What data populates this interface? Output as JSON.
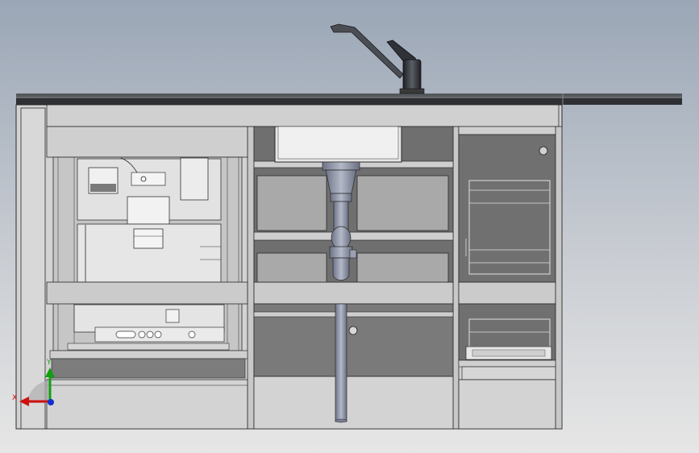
{
  "view": {
    "title": "",
    "colors": {
      "background_top": "#9aa6b6",
      "background_bottom": "#e6e6e6",
      "cabinet_face": "#d3d3d3",
      "cabinet_dark": "#6f6f6f",
      "line": "#2a2a2a",
      "pipe": "#8c93a6",
      "countertop": "#2e3033",
      "faucet": "#3a3d42"
    }
  },
  "triad": {
    "x_label": "X",
    "y_label": "Y",
    "x_color": "#d01010",
    "y_color": "#10a010",
    "z_color": "#1030d0",
    "icon": "coordinate-triad-icon"
  },
  "components": [
    "countertop",
    "faucet",
    "sink-basin",
    "drain-pipe",
    "left-appliance-bay",
    "center-drawers",
    "right-rack-cabinet"
  ]
}
